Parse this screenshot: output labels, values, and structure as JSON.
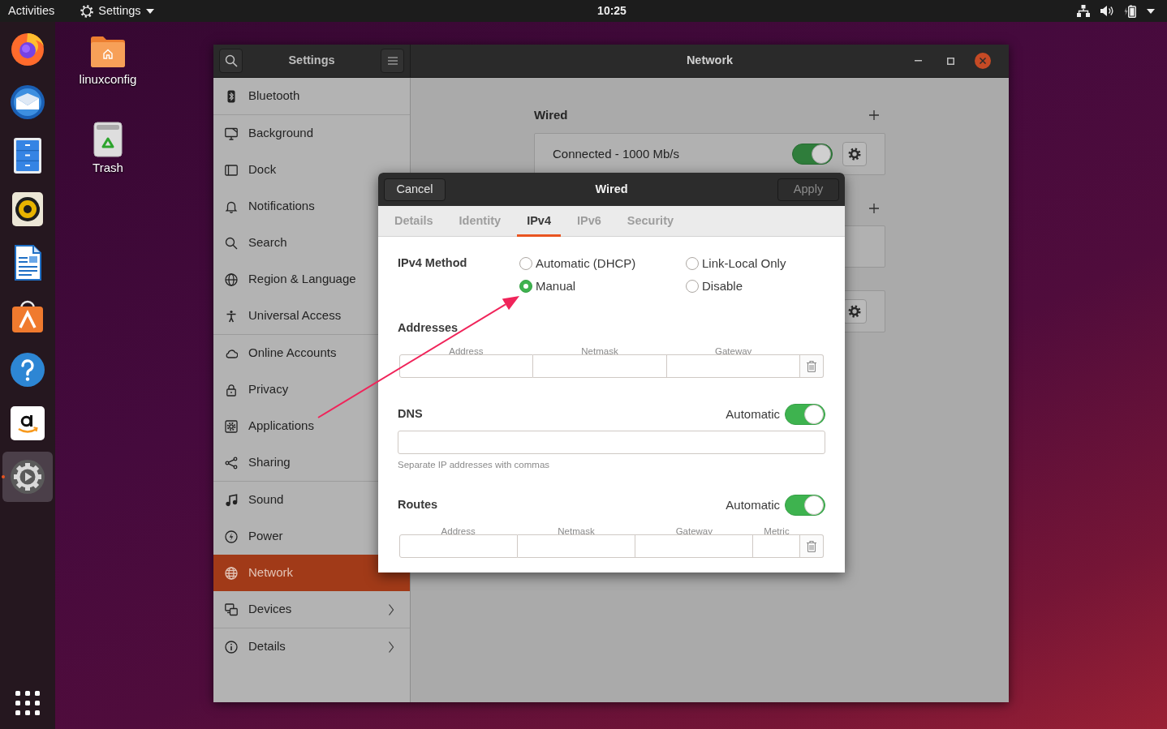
{
  "top_bar": {
    "activities": "Activities",
    "app_menu": "Settings",
    "clock": "10:25"
  },
  "dock": {
    "items": [
      {
        "kind": "browser",
        "selected": false,
        "running": false
      },
      {
        "kind": "mail",
        "selected": false,
        "running": false
      },
      {
        "kind": "files",
        "selected": false,
        "running": false
      },
      {
        "kind": "music",
        "selected": false,
        "running": false
      },
      {
        "kind": "writer",
        "selected": false,
        "running": false
      },
      {
        "kind": "software",
        "selected": false,
        "running": false
      },
      {
        "kind": "help",
        "selected": false,
        "running": false
      },
      {
        "kind": "shop",
        "selected": false,
        "running": false
      },
      {
        "kind": "settings",
        "selected": true,
        "running": true
      }
    ]
  },
  "desktop": {
    "icons": [
      {
        "kind": "home-folder",
        "label": "linuxconfig"
      },
      {
        "kind": "trash",
        "label": "Trash"
      }
    ]
  },
  "settings_window": {
    "sidebar_title": "Settings",
    "title": "Network",
    "sidebar": {
      "groups": [
        {
          "items": [
            {
              "kind": "bluetooth",
              "label": "Bluetooth",
              "selected": false,
              "has_submenu": false
            }
          ]
        },
        {
          "items": [
            {
              "kind": "background",
              "label": "Background",
              "selected": false,
              "has_submenu": false
            },
            {
              "kind": "dock",
              "label": "Dock",
              "selected": false,
              "has_submenu": false
            },
            {
              "kind": "notifications",
              "label": "Notifications",
              "selected": false,
              "has_submenu": false
            },
            {
              "kind": "search",
              "label": "Search",
              "selected": false,
              "has_submenu": false
            },
            {
              "kind": "region",
              "label": "Region & Language",
              "selected": false,
              "has_submenu": false
            },
            {
              "kind": "accessibility",
              "label": "Universal Access",
              "selected": false,
              "has_submenu": false
            }
          ]
        },
        {
          "items": [
            {
              "kind": "accounts",
              "label": "Online Accounts",
              "selected": false,
              "has_submenu": false
            },
            {
              "kind": "privacy",
              "label": "Privacy",
              "selected": false,
              "has_submenu": false
            },
            {
              "kind": "applications",
              "label": "Applications",
              "selected": false,
              "has_submenu": false
            },
            {
              "kind": "sharing",
              "label": "Sharing",
              "selected": false,
              "has_submenu": false
            }
          ]
        },
        {
          "items": [
            {
              "kind": "sound",
              "label": "Sound",
              "selected": false,
              "has_submenu": false
            },
            {
              "kind": "power",
              "label": "Power",
              "selected": false,
              "has_submenu": false
            },
            {
              "kind": "network",
              "label": "Network",
              "selected": true,
              "has_submenu": false
            },
            {
              "kind": "devices",
              "label": "Devices",
              "selected": false,
              "has_submenu": true
            }
          ]
        },
        {
          "items": [
            {
              "kind": "details",
              "label": "Details",
              "selected": false,
              "has_submenu": true
            }
          ]
        }
      ]
    },
    "network_panel": {
      "sections": [
        {
          "title": "Wired",
          "add_button": true,
          "rows": [
            {
              "label": "Connected - 1000 Mb/s",
              "switch": {
                "on": true
              },
              "settings_button": true
            }
          ]
        },
        {
          "add_button": true,
          "rows": [
            {
              "settings_button": false
            }
          ]
        },
        {
          "add_button": false,
          "rows": [
            {
              "settings_button": true
            }
          ]
        }
      ]
    }
  },
  "dialog": {
    "title": "Wired",
    "cancel": "Cancel",
    "apply": {
      "label": "Apply",
      "disabled": true
    },
    "tabs": [
      {
        "label": "Details",
        "selected": false
      },
      {
        "label": "Identity",
        "selected": false
      },
      {
        "label": "IPv4",
        "selected": true
      },
      {
        "label": "IPv6",
        "selected": false
      },
      {
        "label": "Security",
        "selected": false
      }
    ],
    "ipv4_method": {
      "label": "IPv4 Method",
      "options": [
        {
          "label": "Automatic (DHCP)",
          "selected": false
        },
        {
          "label": "Manual",
          "selected": true
        },
        {
          "label": "Link-Local Only",
          "selected": false
        },
        {
          "label": "Disable",
          "selected": false
        }
      ]
    },
    "addresses": {
      "title": "Addresses",
      "columns": [
        "Address",
        "Netmask",
        "Gateway"
      ]
    },
    "dns": {
      "title": "DNS",
      "automatic_label": "Automatic",
      "automatic": true,
      "hint": "Separate IP addresses with commas"
    },
    "routes": {
      "title": "Routes",
      "automatic_label": "Automatic",
      "automatic": true,
      "columns": [
        "Address",
        "Netmask",
        "Gateway",
        "Metric"
      ]
    }
  },
  "annotation": {
    "kind": "arrow"
  }
}
